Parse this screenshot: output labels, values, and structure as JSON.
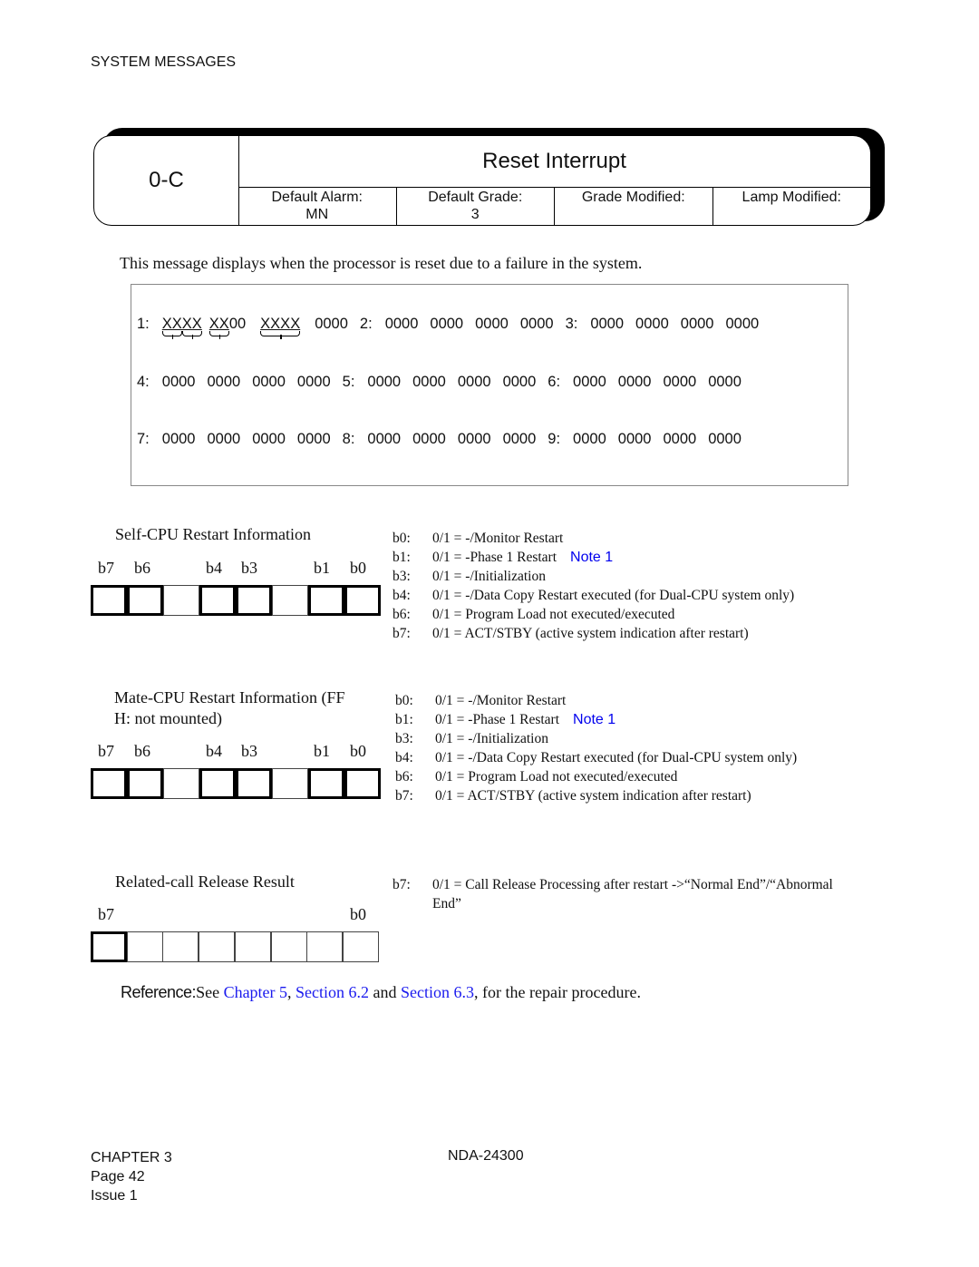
{
  "running_header": "SYSTEM MESSAGES",
  "message_card": {
    "code": "0-C",
    "title": "Reset Interrupt",
    "attributes": [
      {
        "label": "Default Alarm:",
        "value": "MN"
      },
      {
        "label": "Default Grade:",
        "value": "3"
      },
      {
        "label": "Grade Modified:",
        "value": ""
      },
      {
        "label": "Lamp Modified:",
        "value": ""
      }
    ]
  },
  "intro": "This message displays when the processor is reset due to a failure in the system.",
  "data_lines": [
    {
      "groups": [
        {
          "label": "1:",
          "words": [
            "XXXX",
            "XX00",
            "XXXX",
            "0000"
          ]
        },
        {
          "label": "2:",
          "words": [
            "0000",
            "0000",
            "0000",
            "0000"
          ]
        },
        {
          "label": "3:",
          "words": [
            "0000",
            "0000",
            "0000",
            "0000"
          ]
        }
      ]
    },
    {
      "groups": [
        {
          "label": "4:",
          "words": [
            "0000",
            "0000",
            "0000",
            "0000"
          ]
        },
        {
          "label": "5:",
          "words": [
            "0000",
            "0000",
            "0000",
            "0000"
          ]
        },
        {
          "label": "6:",
          "words": [
            "0000",
            "0000",
            "0000",
            "0000"
          ]
        }
      ]
    },
    {
      "groups": [
        {
          "label": "7:",
          "words": [
            "0000",
            "0000",
            "0000",
            "0000"
          ]
        },
        {
          "label": "8:",
          "words": [
            "0000",
            "0000",
            "0000",
            "0000"
          ]
        },
        {
          "label": "9:",
          "words": [
            "0000",
            "0000",
            "0000",
            "0000"
          ]
        }
      ]
    }
  ],
  "sections": [
    {
      "title": "Self-CPU Restart Information",
      "bit_labels": [
        "b7",
        "b6",
        "b4",
        "b3",
        "b1",
        "b0"
      ],
      "descriptions": [
        {
          "bit": "b0:",
          "text": "0/1 = -/Monitor Restart",
          "note": ""
        },
        {
          "bit": "b1:",
          "text": "0/1 = -Phase 1 Restart",
          "note": "Note 1"
        },
        {
          "bit": "b3:",
          "text": "0/1 = -/Initialization",
          "note": ""
        },
        {
          "bit": "b4:",
          "text": "0/1 = -/Data Copy Restart executed (for Dual-CPU system only)",
          "note": ""
        },
        {
          "bit": "b6:",
          "text": "0/1 = Program Load not executed/executed",
          "note": ""
        },
        {
          "bit": "b7:",
          "text": "0/1 = ACT/STBY (active system indication after restart)",
          "note": ""
        }
      ]
    },
    {
      "title": "Mate-CPU Restart Information (FF\nH: not mounted)",
      "bit_labels": [
        "b7",
        "b6",
        "b4",
        "b3",
        "b1",
        "b0"
      ],
      "descriptions": [
        {
          "bit": "b0:",
          "text": "0/1 = -/Monitor Restart",
          "note": ""
        },
        {
          "bit": "b1:",
          "text": "0/1 = -Phase 1 Restart",
          "note": "Note 1"
        },
        {
          "bit": "b3:",
          "text": "0/1 = -/Initialization",
          "note": ""
        },
        {
          "bit": "b4:",
          "text": "0/1 = -/Data Copy Restart executed (for Dual-CPU system only)",
          "note": ""
        },
        {
          "bit": "b6:",
          "text": "0/1 = Program Load not executed/executed",
          "note": ""
        },
        {
          "bit": "b7:",
          "text": "0/1 = ACT/STBY (active system indication after restart)",
          "note": ""
        }
      ]
    },
    {
      "title": "Related-call Release Result",
      "bit_labels": [
        "b7",
        "b0"
      ],
      "descriptions": [
        {
          "bit": "b7:",
          "text": "0/1 = Call Release Processing after restart ->“Normal End”/“Abnormal",
          "note": ""
        },
        {
          "bit": "",
          "text": "End”",
          "note": ""
        }
      ]
    }
  ],
  "reference": {
    "label": "Reference:",
    "prefix": "See ",
    "link1": "Chapter 5",
    "sep1": ", ",
    "link2": "Section 6.2",
    "sep2": " and ",
    "link3": "Section 6.3",
    "suffix": ", for the repair procedure."
  },
  "footer": {
    "chapter": "CHAPTER 3",
    "page": "Page 42",
    "issue": "Issue 1",
    "doc_number": "NDA-24300"
  },
  "colors": {
    "link": "#1a1aee",
    "note": "#0000ee"
  }
}
